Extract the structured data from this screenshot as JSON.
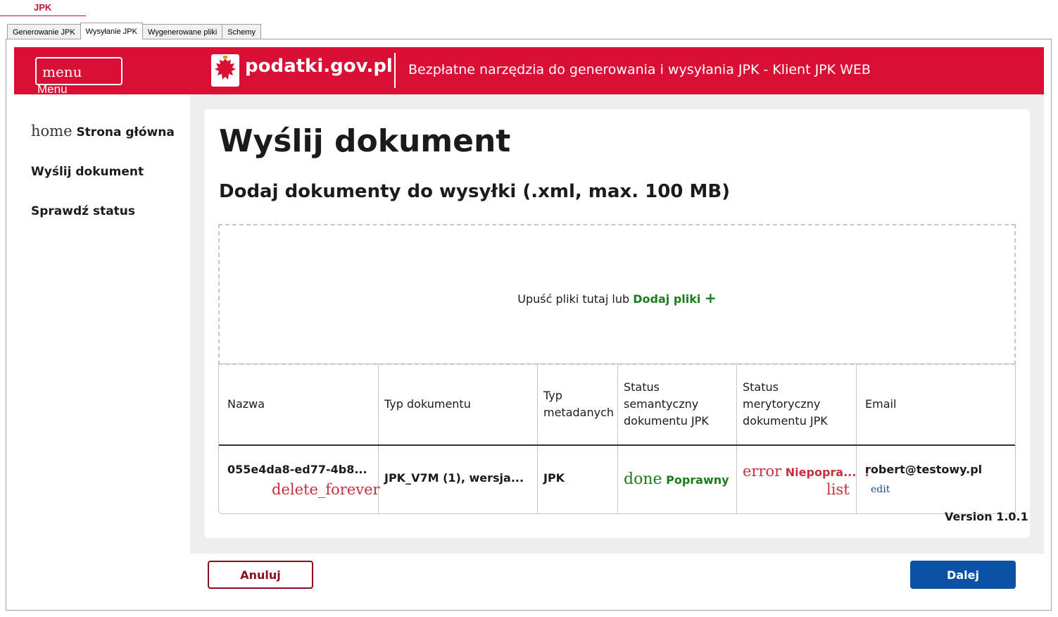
{
  "app": {
    "title": "JPK"
  },
  "tabs": [
    "Generowanie JPK",
    "Wysyłanie JPK",
    "Wygenerowane pliki",
    "Schemy"
  ],
  "header": {
    "menu_icon": "menu",
    "menu_label": "Menu",
    "logo_text": "podatki.gov.pl",
    "subtitle": "Bezpłatne narzędzia do generowania i wysyłania JPK - Klient JPK WEB"
  },
  "sidebar": {
    "items": [
      {
        "icon": "home",
        "label": "Strona główna"
      },
      {
        "label": "Wyślij dokument"
      },
      {
        "label": "Sprawdź status"
      }
    ]
  },
  "main": {
    "title": "Wyślij dokument",
    "subtitle": "Dodaj dokumenty do wysyłki (.xml, max. 100 MB)",
    "dropzone": {
      "text": "Upuść pliki tutaj lub",
      "link": "Dodaj pliki",
      "plus": "+"
    }
  },
  "table": {
    "headers": {
      "name": "Nazwa",
      "type": "Typ dokumentu",
      "meta_1": "Typ",
      "meta_2": "metadanych",
      "sem_1": "Status",
      "sem_2": "semantyczny",
      "sem_3": "dokumentu JPK",
      "mer_1": "Status",
      "mer_2": "merytoryczny",
      "mer_3": "dokumentu JPK",
      "email": "Email"
    },
    "row": {
      "name": "055e4da8-ed77-4b8...",
      "delete_icon": "delete_forever",
      "type": "JPK_V7M (1), wersja...",
      "meta": "JPK",
      "sem_icon": "done",
      "sem_status": "Poprawny",
      "mer_icon": "error",
      "mer_status": "Niepopra...",
      "mer_mark": "!",
      "list_icon": "list",
      "email": "robert@testowy.pl",
      "edit_icon": "edit"
    }
  },
  "version": "Version 1.0.1",
  "buttons": {
    "cancel": "Anuluj",
    "next": "Dalej"
  },
  "colors": {
    "brand_red": "#d90f36",
    "primary_blue": "#0b51a6",
    "success_green": "#1a7d1a",
    "error_red": "#c6303e"
  }
}
